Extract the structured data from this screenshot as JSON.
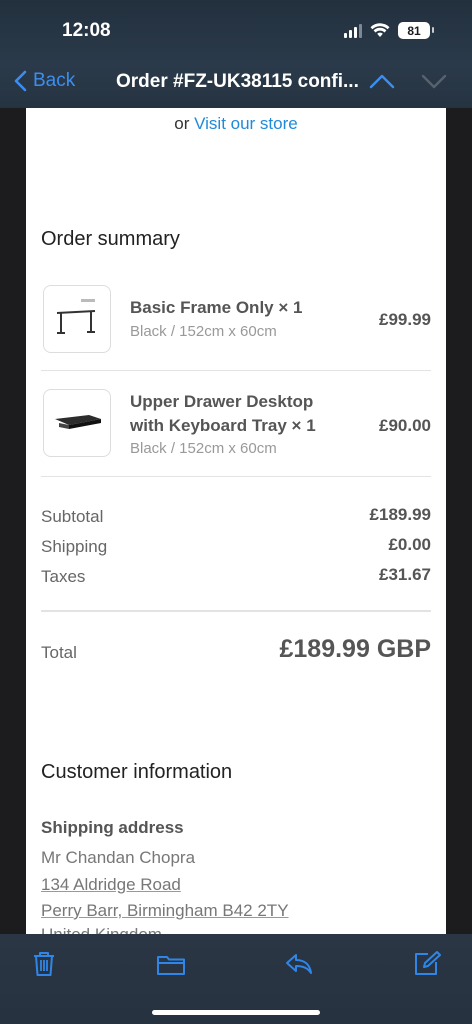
{
  "status": {
    "time": "12:08",
    "battery": "81"
  },
  "nav": {
    "back_label": "Back",
    "title": "Order #FZ-UK38115 confi..."
  },
  "store": {
    "prefix": "or",
    "link": "Visit our store"
  },
  "summary": {
    "title": "Order summary",
    "items": [
      {
        "name": "Basic Frame Only × 1",
        "variant": "Black / 152cm x 60cm",
        "price": "£99.99"
      },
      {
        "name_line1": "Upper Drawer Desktop",
        "name_line2": "with Keyboard Tray × 1",
        "variant": "Black / 152cm x 60cm",
        "price": "£90.00"
      }
    ],
    "subtotal_label": "Subtotal",
    "subtotal": "£189.99",
    "shipping_label": "Shipping",
    "shipping": "£0.00",
    "taxes_label": "Taxes",
    "taxes": "£31.67",
    "total_label": "Total",
    "total": "£189.99 GBP"
  },
  "customer": {
    "title": "Customer information",
    "shipping_title": "Shipping address",
    "name": "Mr Chandan Chopra",
    "line1": "134 Aldridge Road",
    "line2": "Perry Barr, Birmingham B42 2TY",
    "line3": "United Kingdom"
  },
  "colors": {
    "accent": "#3b8ef0",
    "link": "#1f8ad9",
    "toolbar_icon": "#2f86e8"
  },
  "toolbar": {
    "icons": [
      "trash-icon",
      "folder-icon",
      "reply-icon",
      "compose-icon"
    ]
  }
}
